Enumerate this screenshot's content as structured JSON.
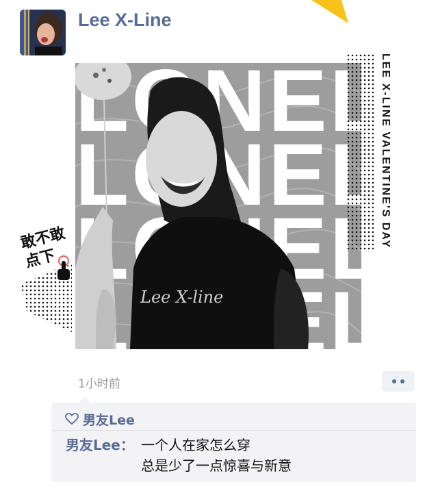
{
  "post": {
    "username": "Lee X-Line",
    "timestamp": "1小时前",
    "image": {
      "big_words": [
        "LONELY",
        "LONELY",
        "LONELY",
        "LONELY"
      ],
      "vertical_text": "LEE X-LINE VALENTINE'S DAY",
      "shirt_logo": "Lee X-line",
      "sticker_text": "敢不敢点下"
    }
  },
  "likes": {
    "names": "男友Lee"
  },
  "comments": [
    {
      "author": "男友Lee：",
      "lines": [
        "一个人在家怎么穿",
        "总是少了一点惊喜与新意"
      ]
    }
  ],
  "colors": {
    "link": "#576b95",
    "accent_yellow": "#f7c21a",
    "comment_bg": "#f3f3f5"
  }
}
